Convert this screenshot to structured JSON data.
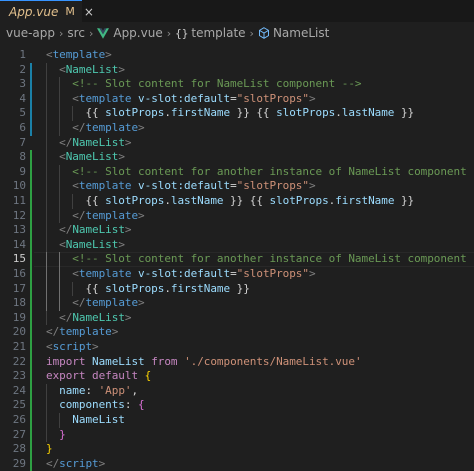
{
  "tab": {
    "title": "App.vue",
    "modified": "M",
    "close": "×"
  },
  "breadcrumb": {
    "items": [
      "vue-app",
      "src",
      "App.vue",
      "template",
      "NameList"
    ]
  },
  "editor": {
    "current_line": 15,
    "lines": [
      {
        "n": "1",
        "t": [
          [
            "t-tag",
            "<"
          ],
          [
            "t-name",
            "template"
          ],
          [
            "t-tag",
            ">"
          ]
        ]
      },
      {
        "n": "2",
        "t": [
          [
            "t-txt",
            "  "
          ],
          [
            "t-tag",
            "<"
          ],
          [
            "t-comp",
            "NameList"
          ],
          [
            "t-tag",
            ">"
          ]
        ]
      },
      {
        "n": "3",
        "t": [
          [
            "t-txt",
            "    "
          ],
          [
            "t-com",
            "<!-- Slot content for NameList component -->"
          ]
        ]
      },
      {
        "n": "4",
        "t": [
          [
            "t-txt",
            "    "
          ],
          [
            "t-tag",
            "<"
          ],
          [
            "t-name",
            "template"
          ],
          [
            "t-txt",
            " "
          ],
          [
            "t-attr",
            "v-slot:default"
          ],
          [
            "t-txt",
            "="
          ],
          [
            "t-str",
            "\"slotProps\""
          ],
          [
            "t-tag",
            ">"
          ]
        ]
      },
      {
        "n": "5",
        "t": [
          [
            "t-txt",
            "      "
          ],
          [
            "t-txt",
            "{{ "
          ],
          [
            "t-prop",
            "slotProps"
          ],
          [
            "t-txt",
            "."
          ],
          [
            "t-prop",
            "firstName"
          ],
          [
            "t-txt",
            " }} {{ "
          ],
          [
            "t-prop",
            "slotProps"
          ],
          [
            "t-txt",
            "."
          ],
          [
            "t-prop",
            "lastName"
          ],
          [
            "t-txt",
            " }}"
          ]
        ]
      },
      {
        "n": "6",
        "t": [
          [
            "t-txt",
            "    "
          ],
          [
            "t-tag",
            "</"
          ],
          [
            "t-name",
            "template"
          ],
          [
            "t-tag",
            ">"
          ]
        ]
      },
      {
        "n": "7",
        "t": [
          [
            "t-txt",
            "  "
          ],
          [
            "t-tag",
            "</"
          ],
          [
            "t-comp",
            "NameList"
          ],
          [
            "t-tag",
            ">"
          ]
        ]
      },
      {
        "n": "8",
        "t": [
          [
            "t-txt",
            "  "
          ],
          [
            "t-tag",
            "<"
          ],
          [
            "t-comp",
            "NameList"
          ],
          [
            "t-tag",
            ">"
          ]
        ]
      },
      {
        "n": "9",
        "t": [
          [
            "t-txt",
            "    "
          ],
          [
            "t-com",
            "<!-- Slot content for another instance of NameList component -->"
          ]
        ]
      },
      {
        "n": "10",
        "t": [
          [
            "t-txt",
            "    "
          ],
          [
            "t-tag",
            "<"
          ],
          [
            "t-name",
            "template"
          ],
          [
            "t-txt",
            " "
          ],
          [
            "t-attr",
            "v-slot:default"
          ],
          [
            "t-txt",
            "="
          ],
          [
            "t-str",
            "\"slotProps\""
          ],
          [
            "t-tag",
            ">"
          ]
        ]
      },
      {
        "n": "11",
        "t": [
          [
            "t-txt",
            "      "
          ],
          [
            "t-txt",
            "{{ "
          ],
          [
            "t-prop",
            "slotProps"
          ],
          [
            "t-txt",
            "."
          ],
          [
            "t-prop",
            "lastName"
          ],
          [
            "t-txt",
            " }} {{ "
          ],
          [
            "t-prop",
            "slotProps"
          ],
          [
            "t-txt",
            "."
          ],
          [
            "t-prop",
            "firstName"
          ],
          [
            "t-txt",
            " }}"
          ]
        ]
      },
      {
        "n": "12",
        "t": [
          [
            "t-txt",
            "    "
          ],
          [
            "t-tag",
            "</"
          ],
          [
            "t-name",
            "template"
          ],
          [
            "t-tag",
            ">"
          ]
        ]
      },
      {
        "n": "13",
        "t": [
          [
            "t-txt",
            "  "
          ],
          [
            "t-tag",
            "</"
          ],
          [
            "t-comp",
            "NameList"
          ],
          [
            "t-tag",
            ">"
          ]
        ]
      },
      {
        "n": "14",
        "t": [
          [
            "t-txt",
            "  "
          ],
          [
            "t-tag",
            "<"
          ],
          [
            "t-comp",
            "NameList"
          ],
          [
            "t-tag",
            ">"
          ]
        ]
      },
      {
        "n": "15",
        "t": [
          [
            "t-txt",
            "    "
          ],
          [
            "t-com",
            "<!-- Slot content for another instance of NameList component -->"
          ]
        ]
      },
      {
        "n": "16",
        "t": [
          [
            "t-txt",
            "    "
          ],
          [
            "t-tag",
            "<"
          ],
          [
            "t-name",
            "template"
          ],
          [
            "t-txt",
            " "
          ],
          [
            "t-attr",
            "v-slot:default"
          ],
          [
            "t-txt",
            "="
          ],
          [
            "t-str",
            "\"slotProps\""
          ],
          [
            "t-tag",
            ">"
          ]
        ]
      },
      {
        "n": "17",
        "t": [
          [
            "t-txt",
            "      "
          ],
          [
            "t-txt",
            "{{ "
          ],
          [
            "t-prop",
            "slotProps"
          ],
          [
            "t-txt",
            "."
          ],
          [
            "t-prop",
            "firstName"
          ],
          [
            "t-txt",
            " }}"
          ]
        ]
      },
      {
        "n": "18",
        "t": [
          [
            "t-txt",
            "    "
          ],
          [
            "t-tag",
            "</"
          ],
          [
            "t-name",
            "template"
          ],
          [
            "t-tag",
            ">"
          ]
        ]
      },
      {
        "n": "19",
        "t": [
          [
            "t-txt",
            "  "
          ],
          [
            "t-tag",
            "</"
          ],
          [
            "t-comp",
            "NameList"
          ],
          [
            "t-tag",
            ">"
          ]
        ]
      },
      {
        "n": "20",
        "t": [
          [
            "t-tag",
            "</"
          ],
          [
            "t-name",
            "template"
          ],
          [
            "t-tag",
            ">"
          ]
        ]
      },
      {
        "n": "21",
        "t": [
          [
            "t-tag",
            "<"
          ],
          [
            "t-name",
            "script"
          ],
          [
            "t-tag",
            ">"
          ]
        ]
      },
      {
        "n": "22",
        "t": [
          [
            "t-kw",
            "import"
          ],
          [
            "t-txt",
            " "
          ],
          [
            "t-prop",
            "NameList"
          ],
          [
            "t-txt",
            " "
          ],
          [
            "t-kw",
            "from"
          ],
          [
            "t-txt",
            " "
          ],
          [
            "t-str",
            "'./components/NameList.vue'"
          ]
        ]
      },
      {
        "n": "23",
        "t": [
          [
            "t-kw",
            "export"
          ],
          [
            "t-txt",
            " "
          ],
          [
            "t-kw",
            "default"
          ],
          [
            "t-txt",
            " "
          ],
          [
            "t-br1",
            "{"
          ]
        ]
      },
      {
        "n": "24",
        "t": [
          [
            "t-txt",
            "  "
          ],
          [
            "t-prop",
            "name"
          ],
          [
            "t-txt",
            ": "
          ],
          [
            "t-str",
            "'App'"
          ],
          [
            "t-txt",
            ","
          ]
        ]
      },
      {
        "n": "25",
        "t": [
          [
            "t-txt",
            "  "
          ],
          [
            "t-prop",
            "components"
          ],
          [
            "t-txt",
            ": "
          ],
          [
            "t-br2",
            "{"
          ]
        ]
      },
      {
        "n": "26",
        "t": [
          [
            "t-txt",
            "    "
          ],
          [
            "t-prop",
            "NameList"
          ]
        ]
      },
      {
        "n": "27",
        "t": [
          [
            "t-txt",
            "  "
          ],
          [
            "t-br2",
            "}"
          ]
        ]
      },
      {
        "n": "28",
        "t": [
          [
            "t-br1",
            "}"
          ]
        ]
      },
      {
        "n": "29",
        "t": [
          [
            "t-tag",
            "</"
          ],
          [
            "t-name",
            "script"
          ],
          [
            "t-tag",
            ">"
          ]
        ]
      }
    ]
  },
  "colors": {
    "background": "#1f1f1f",
    "modified_bar": "#1b81a8",
    "added_bar": "#2ea043",
    "tab_accent": "#3794ff"
  },
  "icons": [
    "vue-logo-icon",
    "chevron-right-icon",
    "braces-icon",
    "cube-icon"
  ]
}
